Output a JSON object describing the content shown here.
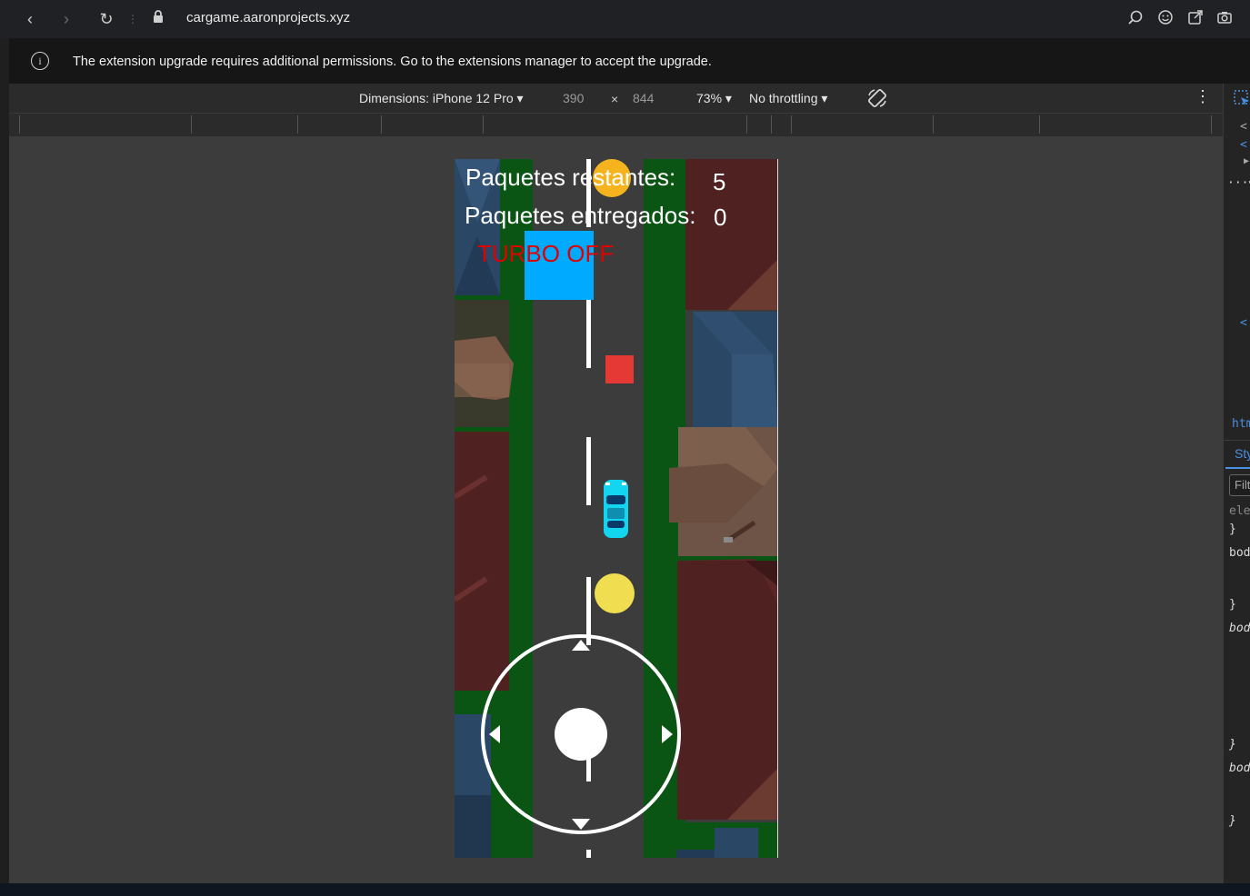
{
  "browser": {
    "url_host": "cargame.aaronprojects.xyz"
  },
  "infobar": {
    "message": "The extension upgrade requires additional permissions. Go to the extensions manager to accept the upgrade."
  },
  "device_toolbar": {
    "dimensions_label": "Dimensions: iPhone 12 Pro",
    "width": "390",
    "times": "×",
    "height": "844",
    "zoom": "73%",
    "throttling": "No throttling"
  },
  "devtools_panel": {
    "lines": [
      "<",
      "<!",
      "▶",
      "▼",
      "<",
      "htm",
      "Sty",
      "Filt",
      "ele",
      "}",
      "bod",
      "}",
      "bod",
      "}",
      "bod",
      "}"
    ]
  },
  "game": {
    "hud": {
      "remaining_label": "Paquetes restantes:",
      "remaining_value": "5",
      "delivered_label": "Paquetes entregados:",
      "delivered_value": "0",
      "turbo_status": "TURBO OFF"
    },
    "colors": {
      "road": "#3c3c3c",
      "grass": "#0b5514",
      "lane_marks": "#ffffff",
      "delivery_box": "#00aaff",
      "obstacle": "#e53935",
      "coin_orange": "#f5b41e",
      "coin_yellow": "#f0de50",
      "car": "#12d6f0",
      "turbo_text": "#e00000"
    }
  }
}
